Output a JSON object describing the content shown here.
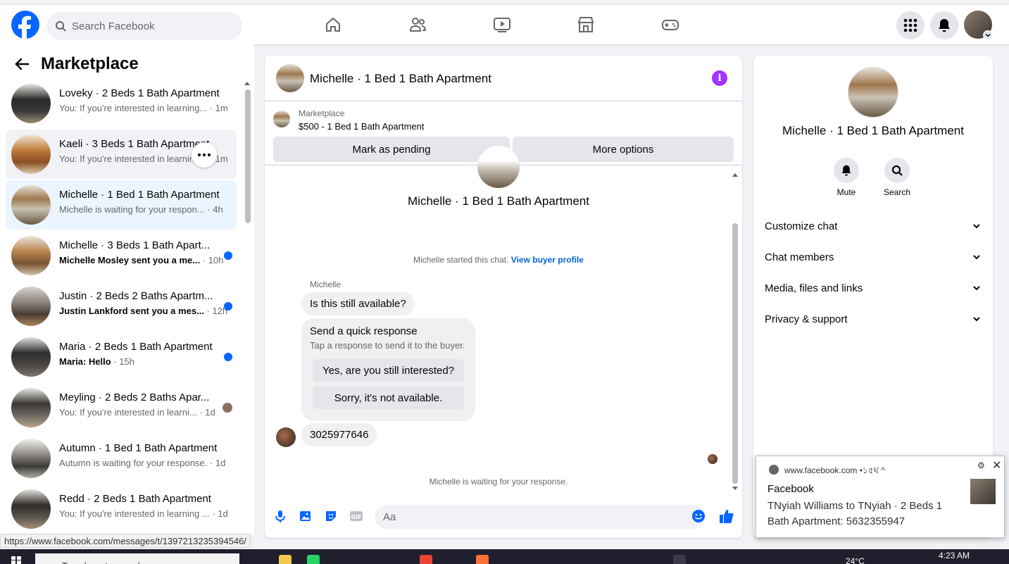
{
  "header": {
    "search_placeholder": "Search Facebook",
    "nav_icons": [
      "home-icon",
      "friends-icon",
      "video-icon",
      "marketplace-icon",
      "gaming-icon"
    ],
    "right_icons": [
      "menu-grid-icon",
      "bell-icon",
      "profile-avatar"
    ]
  },
  "sidebar": {
    "title": "Marketplace",
    "conversations": [
      {
        "title": "Loveky · 2 Beds 1 Bath Apartment",
        "preview": "You: If you're interested in learning...",
        "time": "· 1m",
        "unread": false
      },
      {
        "title": "Kaeli · 3 Beds 1 Bath Apartment",
        "preview": "You: If you're interested in learning...",
        "time": "· 1m",
        "unread": false
      },
      {
        "title": "Michelle · 1 Bed 1 Bath Apartment",
        "preview": "Michelle is waiting for your respon...",
        "time": "· 4h",
        "unread": false
      },
      {
        "title": "Michelle · 3 Beds 1 Bath Apart...",
        "preview": "Michelle Mosley sent you a me...",
        "time": "· 10h",
        "unread": true
      },
      {
        "title": "Justin · 2 Beds 2 Baths Apartm...",
        "preview": "Justin Lankford sent you a mes...",
        "time": "· 12h",
        "unread": true
      },
      {
        "title": "Maria · 2 Beds 1 Bath Apartment",
        "preview": "Maria: Hello",
        "time": "· 15h",
        "unread": true
      },
      {
        "title": "Meyling · 2 Beds 2 Baths Apar...",
        "preview": "You: If you're interested in learni...",
        "time": "· 1d",
        "unread": false
      },
      {
        "title": "Autumn · 1 Bed 1 Bath Apartment",
        "preview": "Autumn is waiting for your response.",
        "time": "· 1d",
        "unread": false
      },
      {
        "title": "Redd · 2 Beds 1 Bath Apartment",
        "preview": "You: If you're interested in learning ...",
        "time": "· 1d",
        "unread": false
      }
    ]
  },
  "status_url": "https://www.facebook.com/messages/t/1397213235394546/",
  "chat": {
    "header_title": "Michelle · 1 Bed 1 Bath Apartment",
    "marketplace_label": "Marketplace",
    "listing": "$500 - 1 Bed 1 Bath Apartment",
    "mark_pending": "Mark as pending",
    "more_options": "More options",
    "intro_title": "Michelle · 1 Bed 1 Bath Apartment",
    "started_text": "Michelle started this chat.",
    "view_profile": "View buyer profile",
    "sender_name": "Michelle",
    "message_1": "Is this still available?",
    "quick_title": "Send a quick response",
    "quick_sub": "Tap a response to send it to the buyer.",
    "quick_1": "Yes, are you still interested?",
    "quick_2": "Sorry, it's not available.",
    "message_2": "3025977646",
    "waiting": "Michelle is waiting for your response.",
    "input_placeholder": "Aa"
  },
  "details": {
    "title": "Michelle · 1 Bed 1 Bath Apartment",
    "mute": "Mute",
    "search": "Search",
    "sections": [
      "Customize chat",
      "Chat members",
      "Media, files and links",
      "Privacy & support"
    ]
  },
  "toast": {
    "source": "www.facebook.com •১৫ঘ ^",
    "title": "Facebook",
    "body": "TNyiah Williams to TNyiah · 2 Beds 1 Bath Apartment: 5632355947"
  },
  "taskbar": {
    "search": "Type here to search",
    "temp": "24°C",
    "time": "4:23 AM"
  },
  "colors": {
    "brand": "#0866ff",
    "info": "#a033ff",
    "link": "#0064d1"
  }
}
